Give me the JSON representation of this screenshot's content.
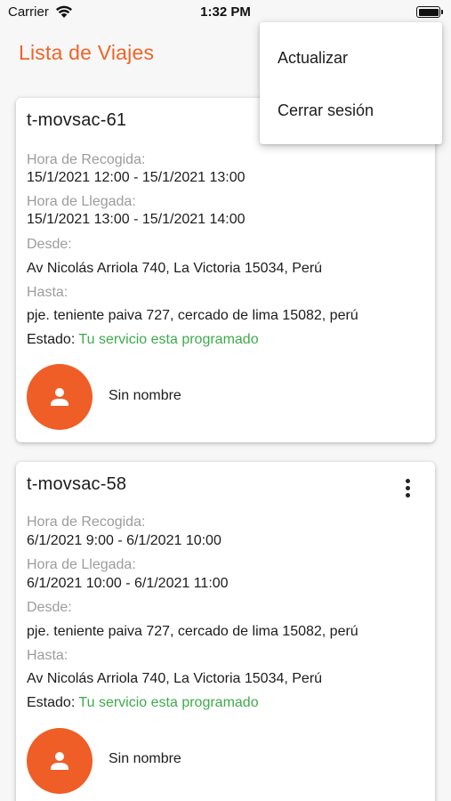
{
  "status_bar": {
    "carrier": "Carrier",
    "time": "1:32 PM"
  },
  "app_bar": {
    "title": "Lista de Viajes"
  },
  "menu": {
    "items": [
      {
        "label": "Actualizar"
      },
      {
        "label": "Cerrar sesión"
      }
    ]
  },
  "labels": {
    "pickup": "Hora de Recogida:",
    "arrival": "Hora de Llegada:",
    "from": "Desde:",
    "to": "Hasta:",
    "status": "Estado: "
  },
  "trips": [
    {
      "code": "t-movsac-61",
      "pickup": "15/1/2021 12:00 - 15/1/2021 13:00",
      "arrival": "15/1/2021 13:00 - 15/1/2021 14:00",
      "from": "Av Nicolás Arriola 740, La Victoria 15034, Perú",
      "to": "pje. teniente paiva 727, cercado de lima 15082, perú",
      "status": "Tu servicio esta programado",
      "driver": "Sin nombre"
    },
    {
      "code": "t-movsac-58",
      "pickup": "6/1/2021 9:00 - 6/1/2021 10:00",
      "arrival": "6/1/2021 10:00 - 6/1/2021 11:00",
      "from": "pje. teniente paiva 727, cercado de lima 15082, perú",
      "to": "Av Nicolás Arriola 740, La Victoria 15034, Perú",
      "status": "Tu servicio esta programado",
      "driver": "Sin nombre"
    }
  ],
  "colors": {
    "accent": "#ef6428",
    "avatar": "#ef5e27",
    "status_ok": "#3eaa4c",
    "label_gray": "#9c9c9c"
  },
  "icons": {
    "wifi": "wifi-icon",
    "battery": "battery-icon",
    "avatar": "person-icon",
    "more": "more-vert-icon"
  }
}
